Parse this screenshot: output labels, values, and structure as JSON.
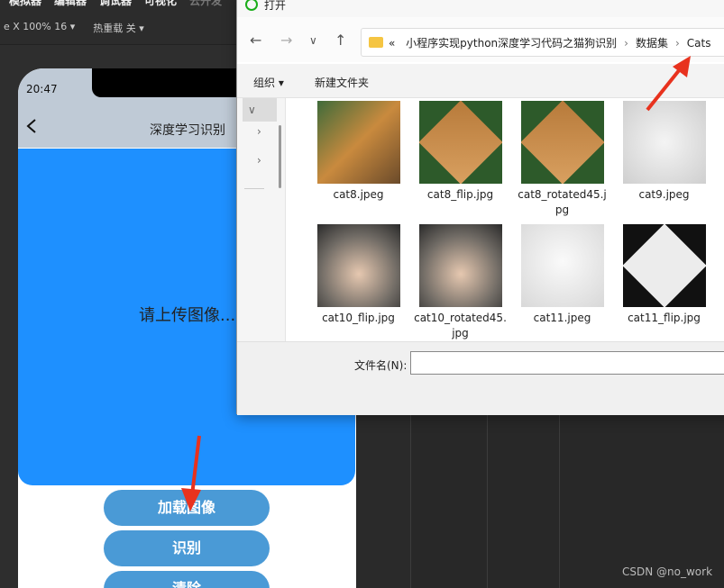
{
  "ide": {
    "menu": [
      "模拟器",
      "编辑器",
      "调试器",
      "可视化",
      "云开发"
    ],
    "toolbar": {
      "device": "e X 100% 16 ▾",
      "hot_reload": "热重载 关 ▾"
    }
  },
  "phone": {
    "time": "20:47",
    "title": "深度学习识别",
    "upload_prompt": "请上传图像...",
    "buttons": {
      "load": "加载图像",
      "recognize": "识别",
      "clear": "清除"
    }
  },
  "dialog": {
    "title": "打开",
    "breadcrumbs": [
      "«",
      "小程序实现python深度学习代码之猫狗识别",
      "数据集",
      "Cats"
    ],
    "organize": "组织 ▾",
    "new_folder": "新建文件夹",
    "filename_label": "文件名(N):",
    "filename_value": "",
    "files": [
      {
        "name": "cat8.jpeg",
        "icon": "cat-orange-thumbnail"
      },
      {
        "name": "cat8_flip.jpg",
        "icon": "cat-orange-diamond-thumbnail"
      },
      {
        "name": "cat8_rotated45.jpg",
        "icon": "cat-orange-diamond-thumbnail"
      },
      {
        "name": "cat9.jpeg",
        "icon": "cat-white-thumbnail"
      },
      {
        "name": "cat10_flip.jpg",
        "icon": "cat-tabby-closeup-thumbnail"
      },
      {
        "name": "cat10_rotated45.jpg",
        "icon": "cat-tabby-closeup-thumbnail"
      },
      {
        "name": "cat11.jpeg",
        "icon": "cat-white-thumbnail"
      },
      {
        "name": "cat11_flip.jpg",
        "icon": "cat-white-diamond-thumbnail"
      }
    ]
  },
  "watermark": "CSDN @no_work",
  "colors": {
    "phone_card": "#1e90ff",
    "phone_button": "#4a9ad6",
    "annotation_arrow": "#e8321e"
  }
}
